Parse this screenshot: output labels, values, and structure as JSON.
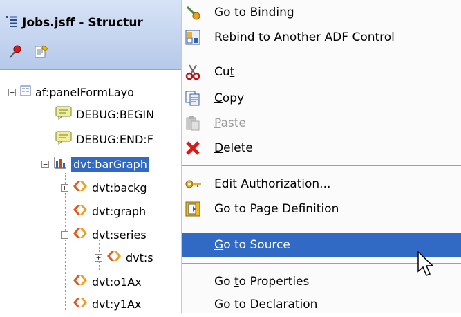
{
  "panel": {
    "title": "Jobs.jsff - Structur",
    "toolbar": [
      {
        "icon": "pushpin-icon"
      },
      {
        "icon": "edit-note-icon"
      }
    ],
    "tree": [
      {
        "label": "af:panelFormLayo",
        "icon": "panel-form-layout-icon",
        "expander": "−"
      },
      {
        "label": "DEBUG:BEGIN",
        "icon": "comment-icon"
      },
      {
        "label": "DEBUG:END:F",
        "icon": "comment-icon"
      },
      {
        "label": "dvt:barGraph",
        "icon": "bar-graph-icon",
        "expander": "−",
        "selected": true
      },
      {
        "label": "dvt:backg",
        "icon": "tag-icon",
        "expander": "+"
      },
      {
        "label": "dvt:graph",
        "icon": "tag-icon"
      },
      {
        "label": "dvt:series",
        "icon": "tag-icon",
        "expander": "−"
      },
      {
        "label": "dvt:s",
        "icon": "tag-icon",
        "expander": "+"
      },
      {
        "label": "dvt:o1Ax",
        "icon": "tag-icon"
      },
      {
        "label": "dvt:y1Ax",
        "icon": "tag-icon"
      }
    ]
  },
  "menu": {
    "items": [
      {
        "pre": "Go to ",
        "u": "B",
        "post": "inding",
        "icon": "binding-icon"
      },
      {
        "pre": "Rebind to Another ADF Control",
        "u": "",
        "post": "",
        "icon": "rebind-icon"
      },
      {
        "pre": "Cu",
        "u": "t",
        "post": "",
        "icon": "scissors-icon"
      },
      {
        "pre": "",
        "u": "C",
        "post": "opy",
        "icon": "copy-icon"
      },
      {
        "pre": "",
        "u": "P",
        "post": "aste",
        "icon": "paste-icon",
        "disabled": true
      },
      {
        "pre": "",
        "u": "D",
        "post": "elete",
        "icon": "delete-icon"
      },
      {
        "pre": "Edit Authorization...",
        "u": "",
        "post": "",
        "icon": "key-icon"
      },
      {
        "pre": "Go to Pa",
        "u": "g",
        "post": "e Definition",
        "icon": "page-definition-icon"
      },
      {
        "pre": "",
        "u": "G",
        "post": "o to Source",
        "icon": "",
        "highlighted": true
      },
      {
        "pre": "Go ",
        "u": "t",
        "post": "o Properties",
        "icon": ""
      },
      {
        "pre": "Go to Declaration",
        "u": "",
        "post": "",
        "icon": ""
      }
    ]
  },
  "colors": {
    "selection": "#316ac5",
    "header": "#b6c9ea"
  }
}
